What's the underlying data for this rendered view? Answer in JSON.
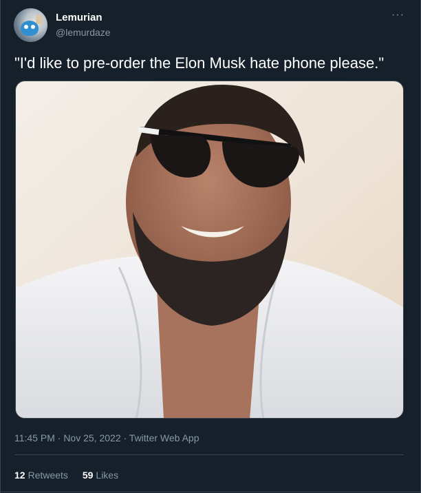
{
  "author": {
    "display_name": "Lemurian",
    "handle": "@lemurdaze",
    "avatar_icon": "avatar-image"
  },
  "tweet": {
    "text": "\"I'd like to pre-order the Elon Musk hate phone please.\"",
    "timestamp": "11:45 PM · Nov 25, 2022 · Twitter Web App"
  },
  "more_menu": {
    "label": "···",
    "icon": "more-horizontal-icon"
  },
  "stats": {
    "retweets_count": "12",
    "retweets_label": "Retweets",
    "likes_count": "59",
    "likes_label": "Likes"
  },
  "colors": {
    "background": "#15202b",
    "text_primary": "#ffffff",
    "text_secondary": "#8899a6",
    "border": "#38444d"
  }
}
